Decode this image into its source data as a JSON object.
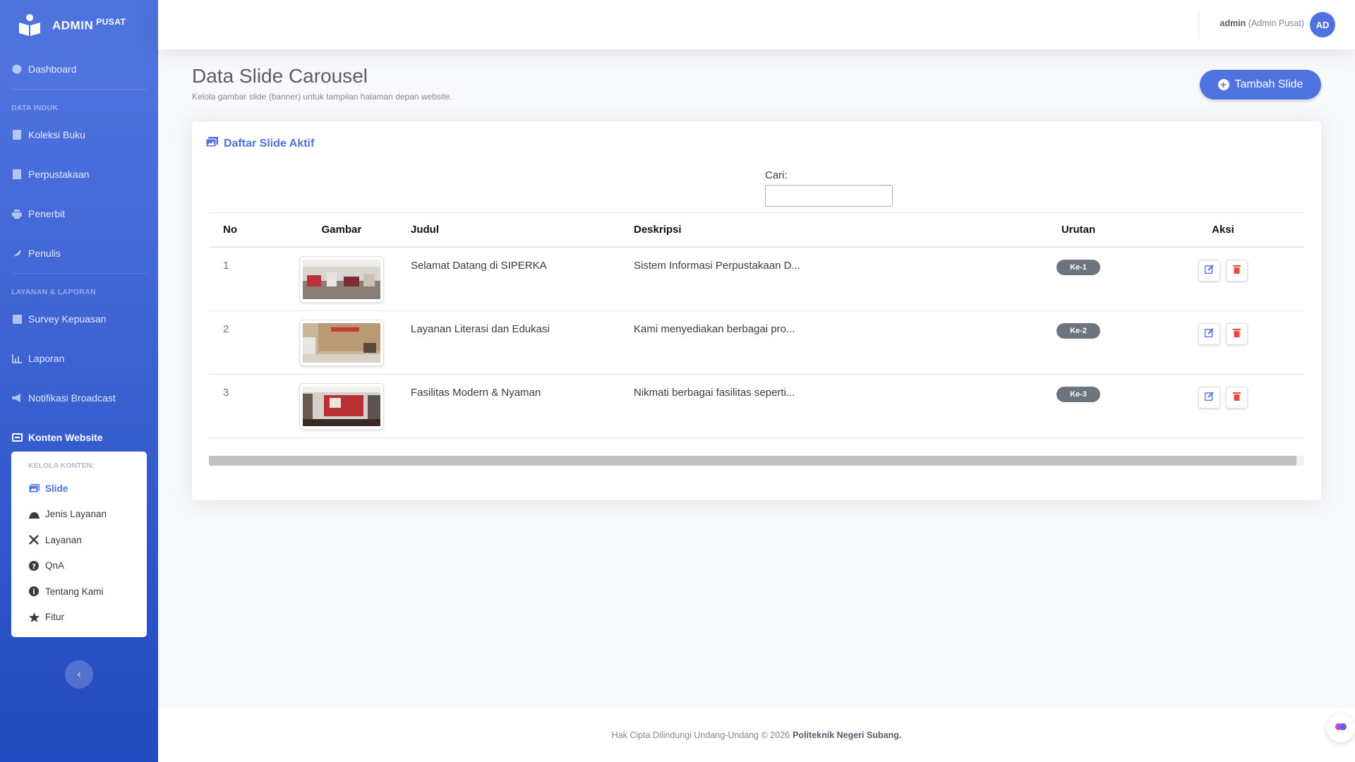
{
  "brand": {
    "name": "Admin",
    "sup": "Pusat"
  },
  "sidebar": {
    "dashboard": "Dashboard",
    "heading_data": "Data Induk",
    "items_data": [
      "Koleksi Buku",
      "Perpustakaan",
      "Penerbit",
      "Penulis"
    ],
    "heading_layanan": "Layanan & Laporan",
    "items_layanan": [
      "Survey Kepuasan",
      "Laporan",
      "Notifikasi Broadcast"
    ],
    "konten": "Konten Website",
    "submenu_heading": "Kelola Konten:",
    "submenu": [
      "Slide",
      "Jenis Layanan",
      "Layanan",
      "QnA",
      "Tentang Kami",
      "Fitur"
    ]
  },
  "topbar": {
    "user": "admin",
    "role": "(Admin Pusat)",
    "avatar": "AD"
  },
  "page": {
    "title": "Data Slide Carousel",
    "subtitle": "Kelola gambar slide (banner) untuk tampilan halaman depan website.",
    "add_button": "Tambah Slide"
  },
  "card": {
    "title": "Daftar Slide Aktif",
    "search_label": "Cari:"
  },
  "table": {
    "headers": [
      "No",
      "Gambar",
      "Judul",
      "Deskripsi",
      "Urutan",
      "Aksi"
    ],
    "rows": [
      {
        "no": "1",
        "judul": "Selamat Datang di SIPERKA",
        "deskripsi": "Sistem Informasi Perpustakaan D...",
        "urutan": "Ke-1"
      },
      {
        "no": "2",
        "judul": "Layanan Literasi dan Edukasi",
        "deskripsi": "Kami menyediakan berbagai pro...",
        "urutan": "Ke-2"
      },
      {
        "no": "3",
        "judul": "Fasilitas Modern & Nyaman",
        "deskripsi": "Nikmati berbagai fasilitas seperti...",
        "urutan": "Ke-3"
      }
    ]
  },
  "footer": {
    "text": "Hak Cipta Dilindungi Undang-Undang © 2026",
    "org": "Politeknik Negeri Subang."
  },
  "colors": {
    "primary": "#4e73df",
    "danger": "#e74a3b",
    "badge": "#6c757d"
  }
}
